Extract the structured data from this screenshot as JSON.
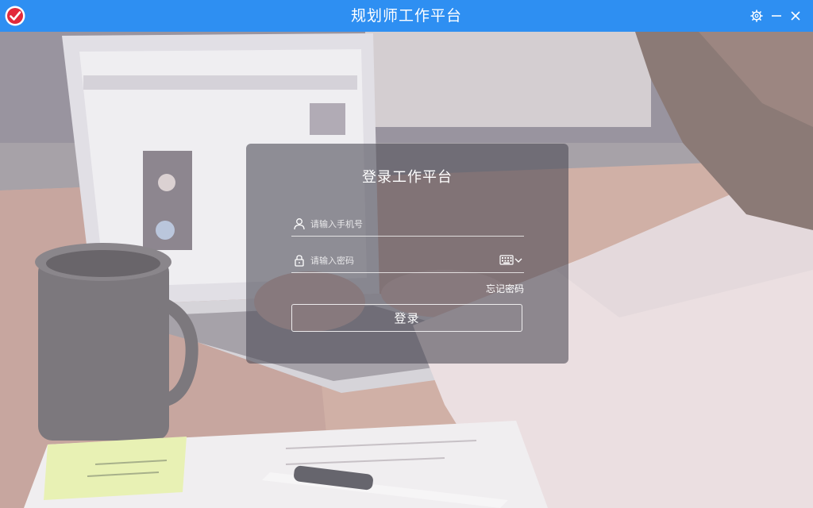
{
  "window": {
    "title": "规划师工作平台",
    "accent_color": "#2e8ff2",
    "logo_icon": "check-mark-circle-icon",
    "controls": [
      "settings-gear-icon",
      "minimize-icon",
      "close-icon"
    ]
  },
  "login": {
    "title": "登录工作平台",
    "phone_placeholder": "请输入手机号",
    "phone_value": "",
    "password_placeholder": "请输入密码",
    "password_value": "",
    "forgot_label": "忘记密码",
    "submit_label": "登录",
    "icons": [
      "user-icon",
      "lock-icon",
      "keyboard-icon"
    ]
  }
}
